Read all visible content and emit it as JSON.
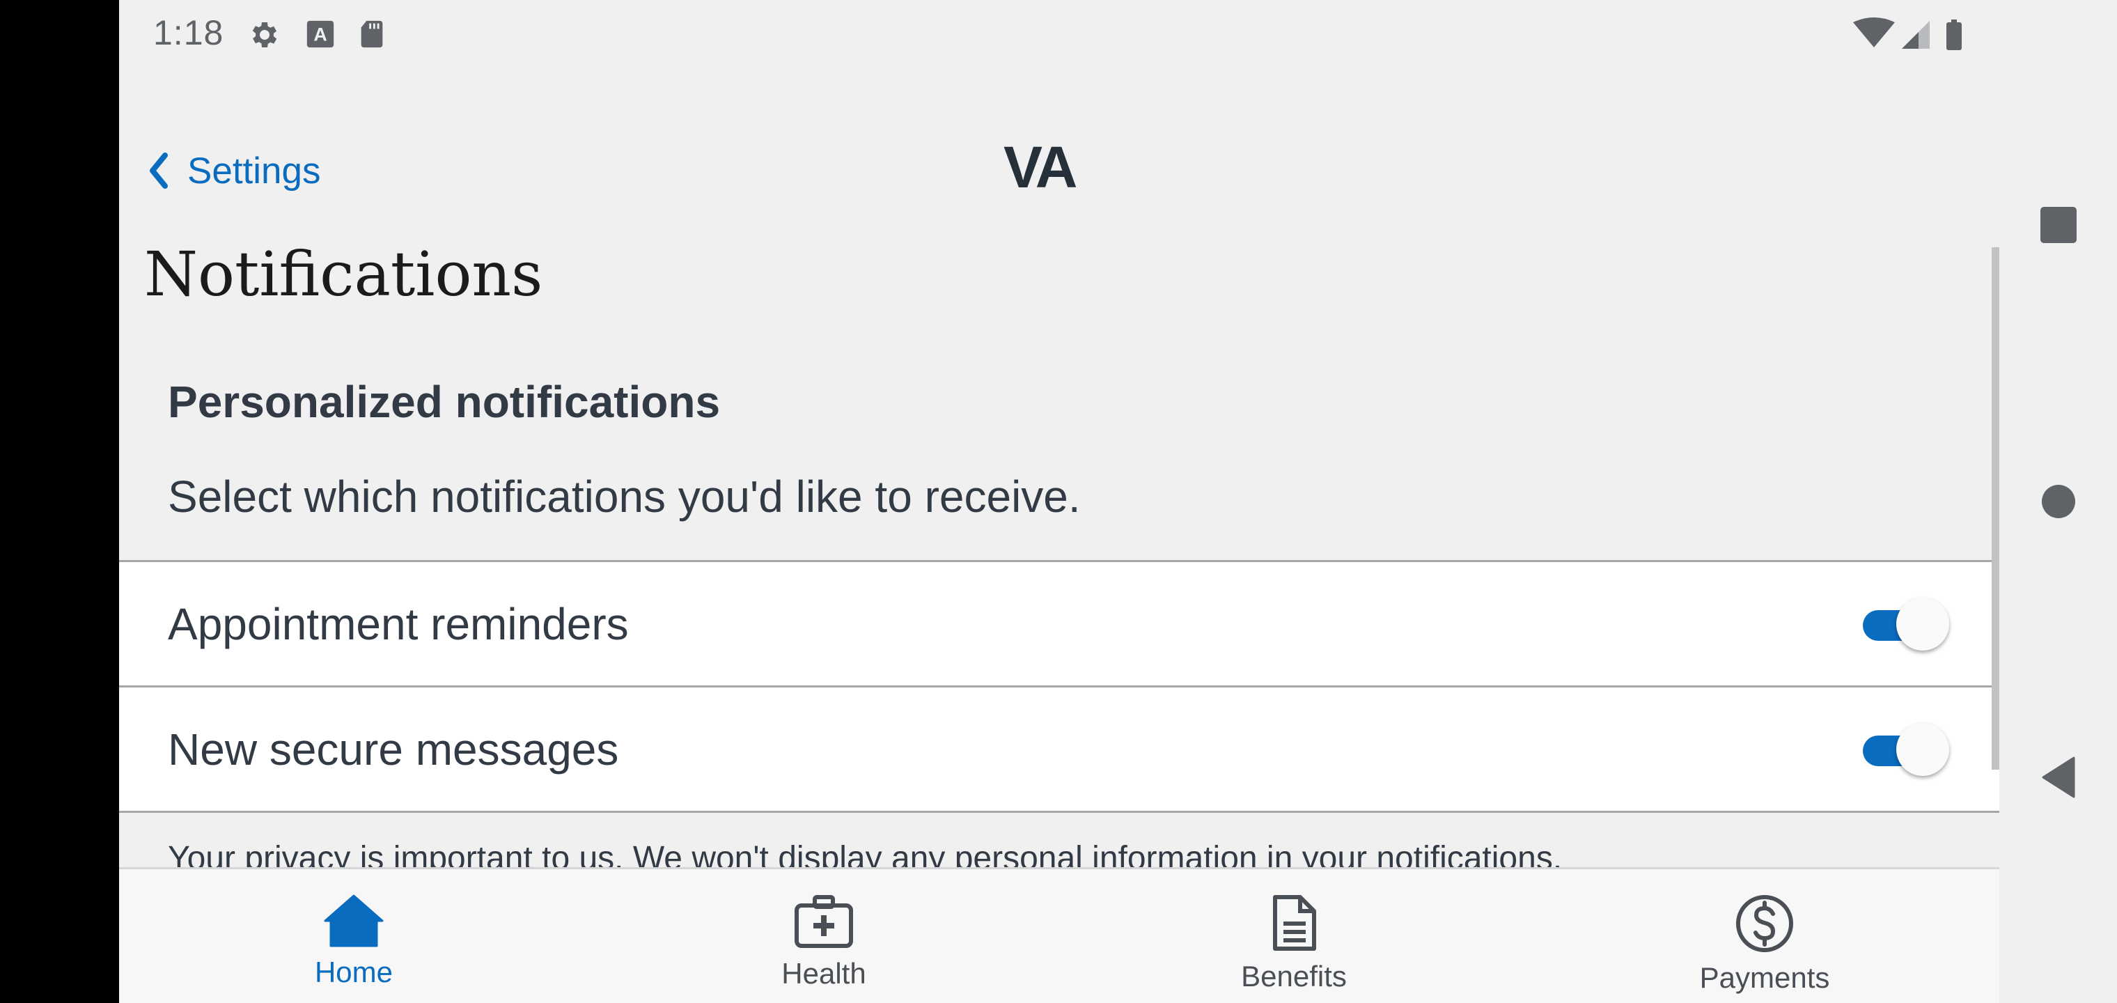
{
  "status_bar": {
    "time": "1:18",
    "left_icons": [
      "settings-gear-icon",
      "text-a-icon",
      "sd-card-icon"
    ],
    "right_icons": [
      "wifi-icon",
      "cell-signal-icon",
      "battery-icon"
    ]
  },
  "header": {
    "back_label": "Settings",
    "logo_text": "VA"
  },
  "page": {
    "title": "Notifications",
    "section_title": "Personalized notifications",
    "section_description": "Select which notifications you'd like to receive.",
    "settings": [
      {
        "label": "Appointment reminders",
        "enabled": true
      },
      {
        "label": "New secure messages",
        "enabled": true
      }
    ],
    "privacy_text": "Your privacy is important to us. We won't display any personal information in your notifications."
  },
  "bottom_nav": {
    "items": [
      {
        "label": "Home",
        "icon": "home-icon",
        "active": true
      },
      {
        "label": "Health",
        "icon": "medical-kit-icon",
        "active": false
      },
      {
        "label": "Benefits",
        "icon": "document-icon",
        "active": false
      },
      {
        "label": "Payments",
        "icon": "dollar-circle-icon",
        "active": false
      }
    ]
  },
  "system_nav": [
    "recents-square-icon",
    "home-circle-icon",
    "back-triangle-icon"
  ],
  "colors": {
    "accent": "#0a6cbf",
    "background": "#f0f0f0",
    "text": "#323a45"
  }
}
